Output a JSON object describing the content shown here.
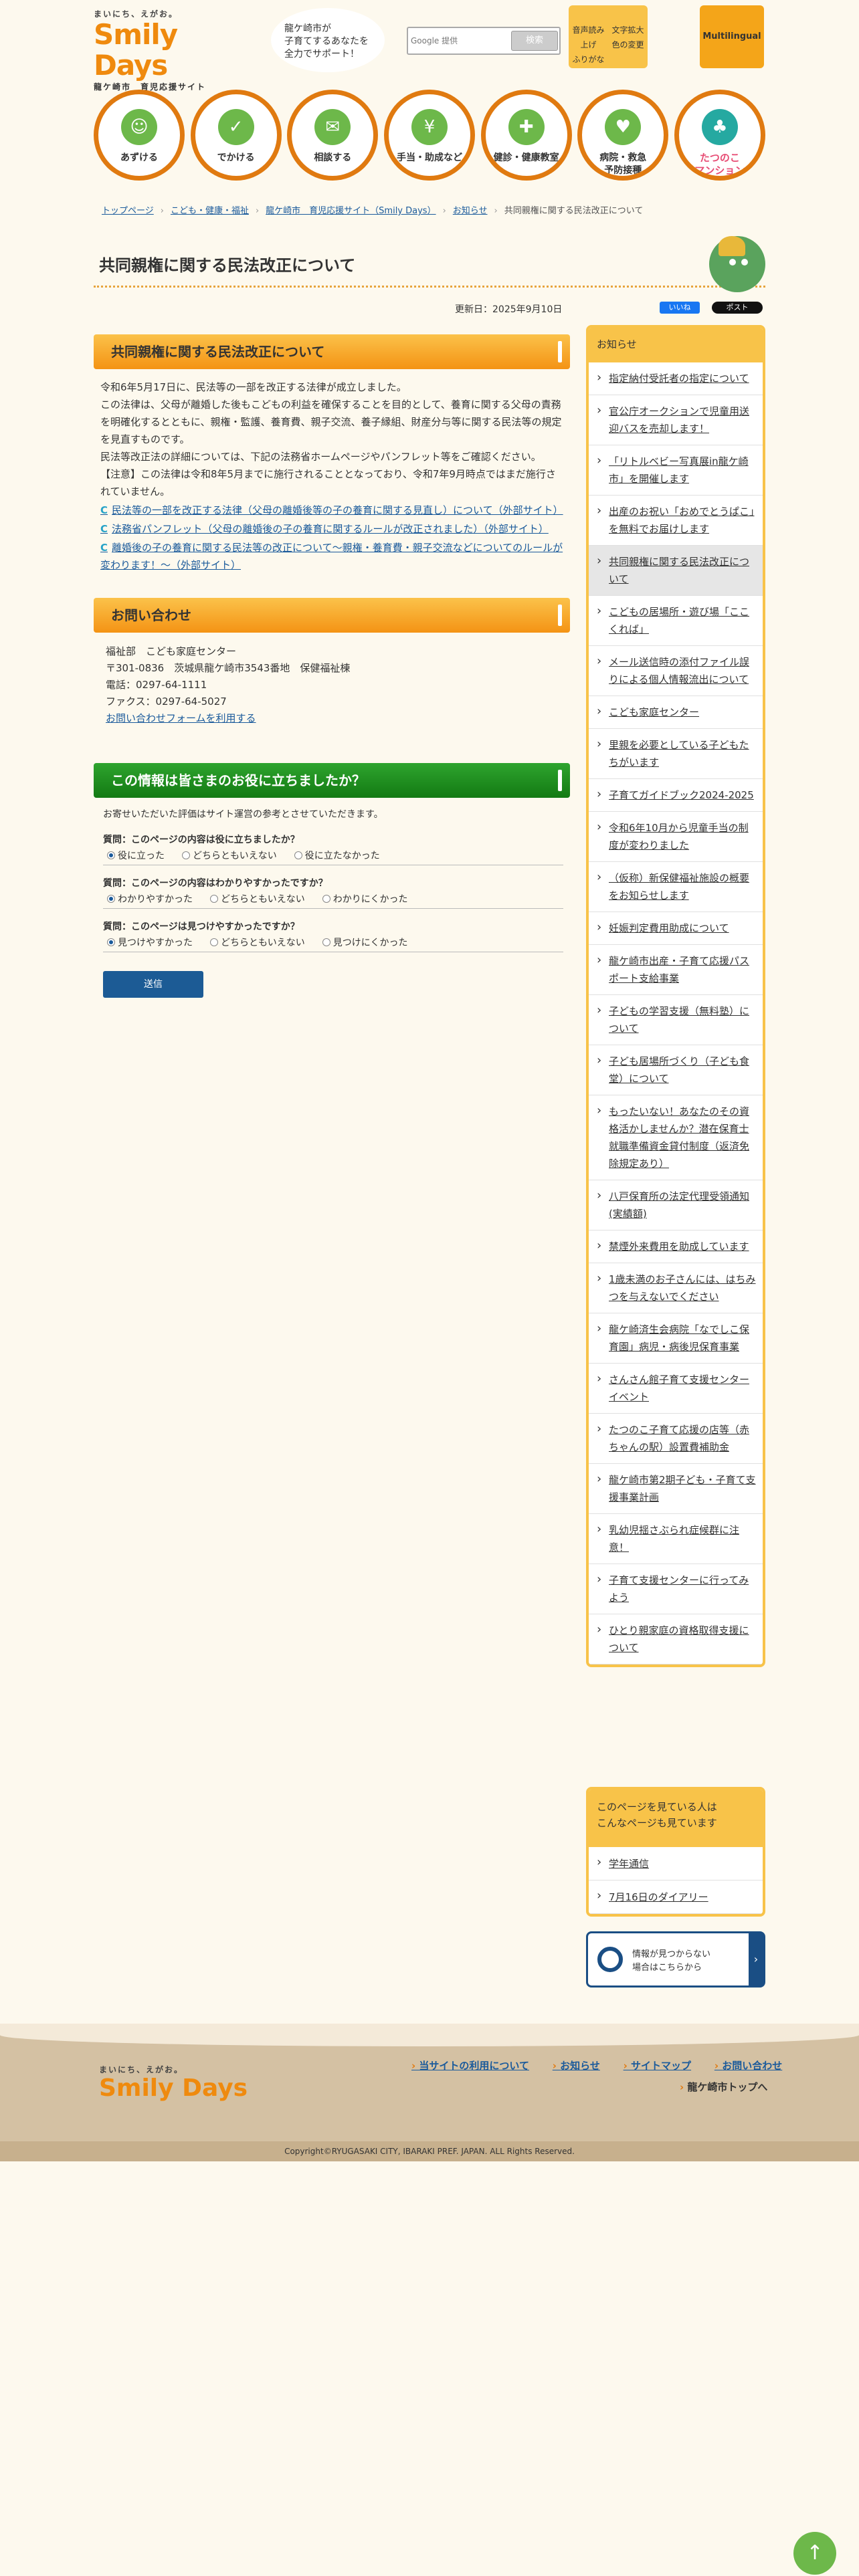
{
  "header": {
    "tagline": "まいにち、えがお。",
    "logo": "Smily Days",
    "site_sub": "龍ケ崎市　育児応援サイト",
    "bubble": "龍ケ崎市が\n子育てするあなたを\n全力でサポート！",
    "search_label": "Google 提供",
    "search_button": "検索",
    "tool_voice": "音声読み上げ\nふりがな",
    "tool_text": "文字拡大\n色の変更",
    "multilingual": "Multilingual"
  },
  "nav": [
    {
      "label": "あずける",
      "icon": "baby-icon"
    },
    {
      "label": "でかける",
      "icon": "stroller-icon"
    },
    {
      "label": "相談する",
      "icon": "chat-icon"
    },
    {
      "label": "手当・助成など",
      "icon": "money-icon"
    },
    {
      "label": "健診・健康教室",
      "icon": "checkup-icon"
    },
    {
      "label": "病院・救急\n予防接種",
      "icon": "doctor-icon"
    },
    {
      "label": "たつのこ\nマンション",
      "icon": "mascot-icon"
    }
  ],
  "breadcrumb": [
    "トップページ",
    "こども・健康・福祉",
    "龍ケ崎市　育児応援サイト（Smily Days）",
    "お知らせ",
    "共同親権に関する民法改正について"
  ],
  "page": {
    "title": "共同親権に関する民法改正について",
    "updated": "更新日：2025年9月10日",
    "fb": "いいね",
    "x": "ポスト"
  },
  "article": {
    "heading": "共同親権に関する民法改正について",
    "p1": "令和6年5月17日に、民法等の一部を改正する法律が成立しました。",
    "p2": "この法律は、父母が離婚した後もこどもの利益を確保することを目的として、養育に関する父母の責務を明確化するとともに、親権・監護、養育費、親子交流、養子縁組、財産分与等に関する民法等の規定を見直すものです。",
    "p3": "民法等改正法の詳細については、下記の法務省ホームページやパンフレット等をご確認ください。",
    "p4": "【注意】この法律は令和8年5月までに施行されることとなっており、令和7年9月時点ではまだ施行されていません。",
    "links": [
      "民法等の一部を改正する法律（父母の離婚後等の子の養育に関する見直し）について（外部サイト）",
      "法務省パンフレット（父母の離婚後の子の養育に関するルールが改正されました）（外部サイト）",
      "離婚後の子の養育に関する民法等の改正について～親権・養育費・親子交流などについてのルールが変わります！～（外部サイト）"
    ]
  },
  "contact": {
    "heading": "お問い合わせ",
    "dept": "福祉部　こども家庭センター",
    "address": "〒301-0836　茨城県龍ケ崎市3543番地　保健福祉棟",
    "tel": "電話：0297-64-1111",
    "fax": "ファクス：0297-64-5027",
    "form": "お問い合わせフォームを利用する"
  },
  "survey": {
    "heading": "この情報は皆さまのお役に立ちましたか？",
    "intro": "お寄せいただいた評価はサイト運営の参考とさせていただきます。",
    "questions": [
      {
        "q": "質問：このページの内容は役に立ちましたか？",
        "o": [
          "役に立った",
          "どちらともいえない",
          "役に立たなかった"
        ]
      },
      {
        "q": "質問：このページの内容はわかりやすかったですか？",
        "o": [
          "わかりやすかった",
          "どちらともいえない",
          "わかりにくかった"
        ]
      },
      {
        "q": "質問：このページは見つけやすかったですか？",
        "o": [
          "見つけやすかった",
          "どちらともいえない",
          "見つけにくかった"
        ]
      }
    ],
    "submit": "送信"
  },
  "sidebar": {
    "heading": "お知らせ",
    "items": [
      "指定納付受託者の指定について",
      "官公庁オークションで児童用送迎バスを売却します！",
      "「リトルベビー写真展in龍ケ崎市」を開催します",
      "出産のお祝い「おめでとうぱこ」を無料でお届けします",
      "共同親権に関する民法改正について",
      "こどもの居場所・遊び場「ここくれば」",
      "メール送信時の添付ファイル誤りによる個人情報流出について",
      "こども家庭センター",
      "里親を必要としている子どもたちがいます",
      "子育てガイドブック2024-2025",
      "令和6年10月から児童手当の制度が変わりました",
      "（仮称）新保健福祉施設の概要をお知らせします",
      "妊娠判定費用助成について",
      "龍ケ崎市出産・子育て応援パスポート支給事業",
      "子どもの学習支援（無料塾）について",
      "子ども居場所づくり（子ども食堂）について",
      "もったいない！あなたのその資格活かしませんか？潜在保育士就職準備資金貸付制度（返済免除規定あり）",
      "八戸保育所の法定代理受領通知(実績額)",
      "禁煙外来費用を助成しています",
      "1歳未満のお子さんには、はちみつを与えないでください",
      "龍ケ崎済生会病院「なでしこ保育園」病児・病後児保育事業",
      "さんさん館子育て支援センターイベント",
      "たつのこ子育て応援の店等（赤ちゃんの駅）設置費補助金",
      "龍ケ崎市第2期子ども・子育て支援事業計画",
      "乳幼児揺さぶられ症候群に注意！",
      "子育て支援センターに行ってみよう",
      "ひとり親家庭の資格取得支援について"
    ],
    "current_index": 4,
    "also_heading": "このページを見ている人は\nこんなページも見ています",
    "also": [
      "学年通信",
      "7月16日のダイアリー"
    ],
    "notfound": "情報が見つからない\n場合はこちらから"
  },
  "footer": {
    "tagline": "まいにち、えがお。",
    "logo": "Smily Days",
    "links": [
      "当サイトの利用について",
      "お知らせ",
      "サイトマップ",
      "お問い合わせ"
    ],
    "top": "龍ケ崎市トップへ",
    "copyright": "Copyright©RYUGASAKI CITY, IBARAKI PREF. JAPAN. ALL Rights Reserved."
  },
  "colors": {
    "accent": "#f49314",
    "green": "#137a13",
    "link": "#1a5a9b",
    "side_border": "#f8c349"
  }
}
